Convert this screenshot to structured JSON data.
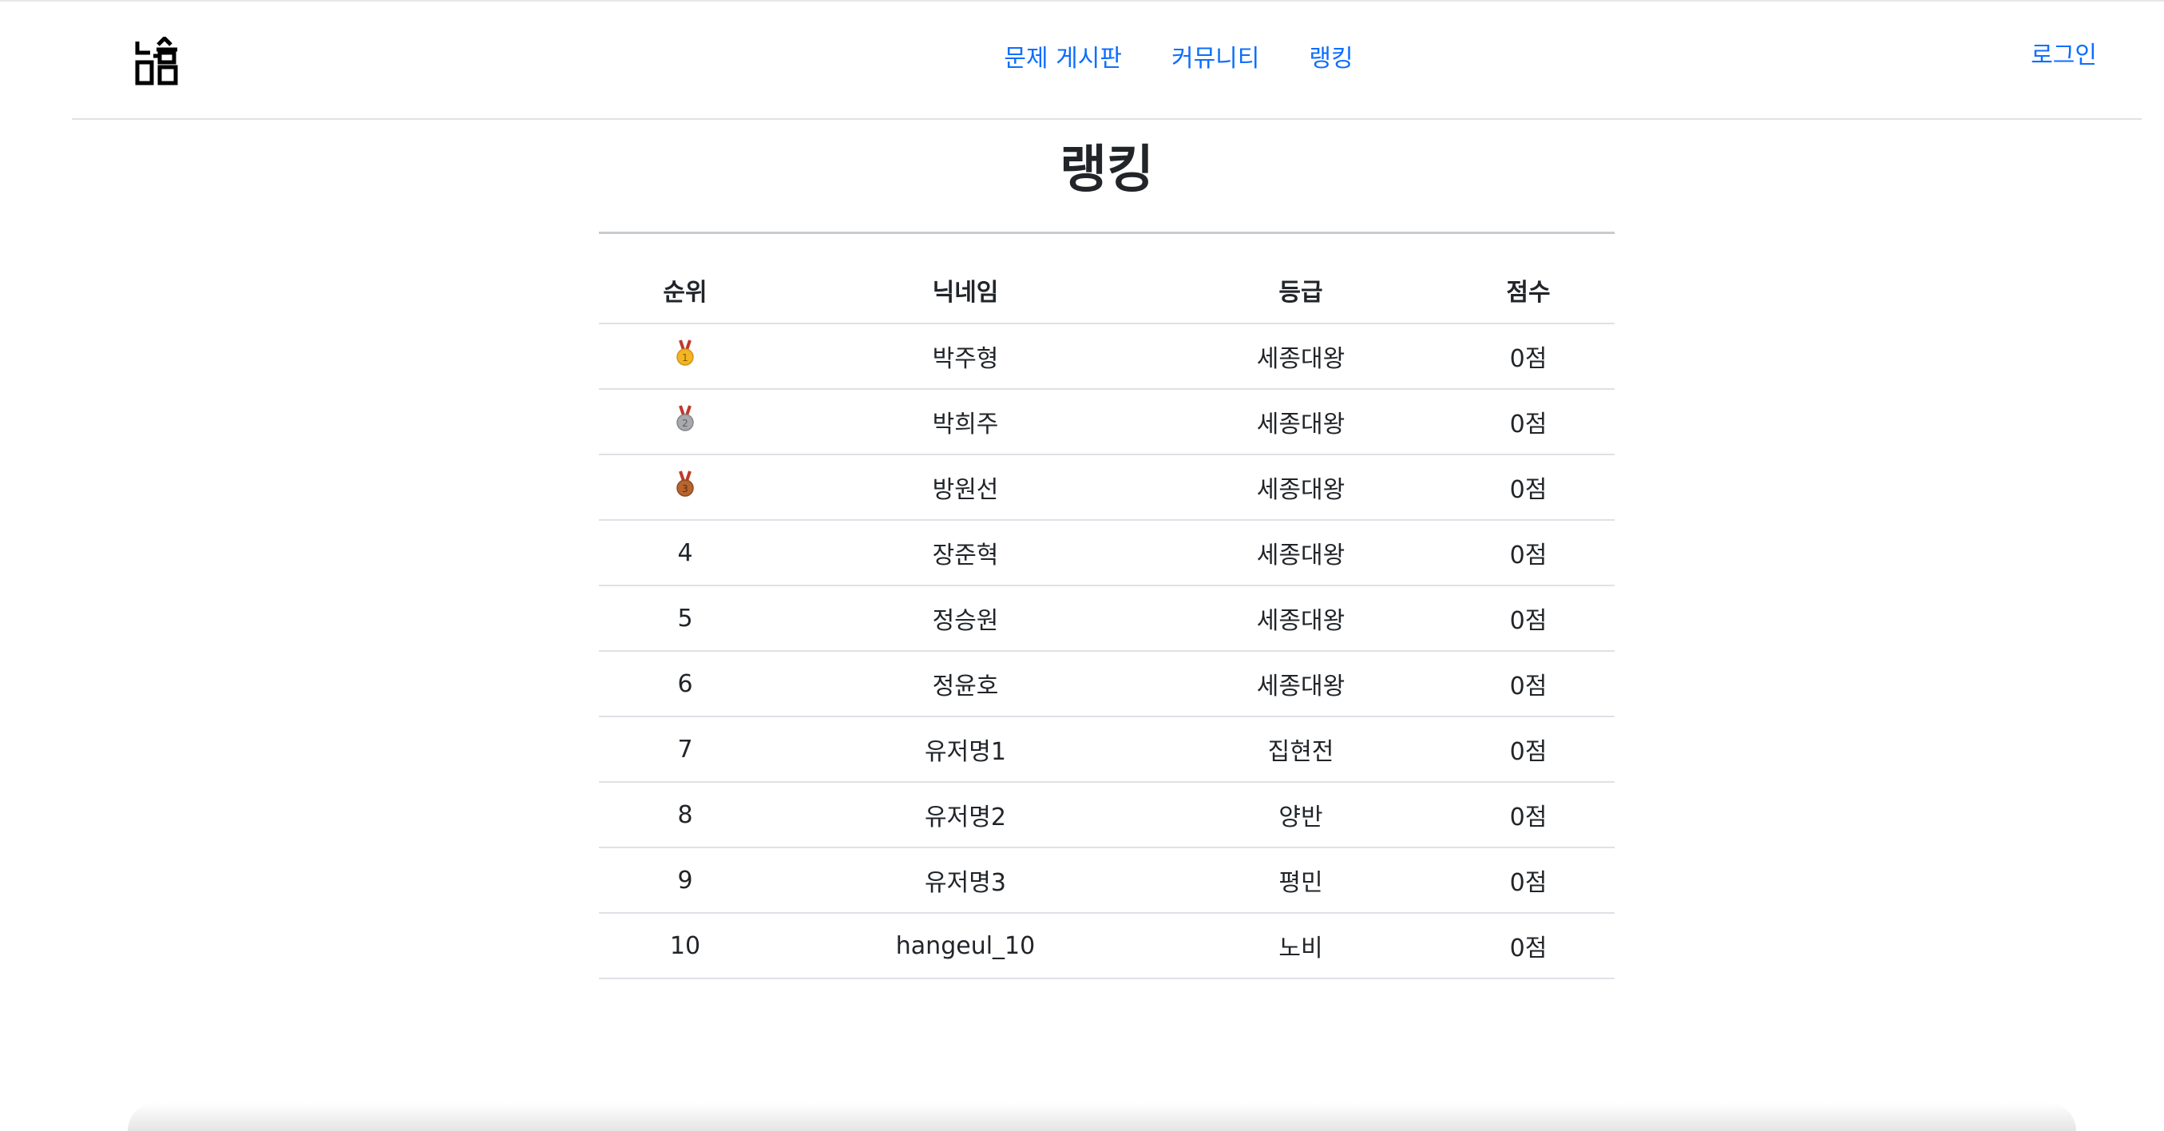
{
  "header": {
    "nav": [
      {
        "label": "문제 게시판"
      },
      {
        "label": "커뮤니티"
      },
      {
        "label": "랭킹"
      }
    ],
    "login_label": "로그인",
    "logo_icon": "hangul-logo-icon"
  },
  "main": {
    "title": "랭킹",
    "table": {
      "headers": {
        "rank": "순위",
        "nickname": "닉네임",
        "grade": "등급",
        "score": "점수"
      },
      "rows": [
        {
          "rank": "1",
          "medal": "gold-medal-icon",
          "nickname": "박주형",
          "grade": "세종대왕",
          "score": "0점"
        },
        {
          "rank": "2",
          "medal": "silver-medal-icon",
          "nickname": "박희주",
          "grade": "세종대왕",
          "score": "0점"
        },
        {
          "rank": "3",
          "medal": "bronze-medal-icon",
          "nickname": "방원선",
          "grade": "세종대왕",
          "score": "0점"
        },
        {
          "rank": "4",
          "nickname": "장준혁",
          "grade": "세종대왕",
          "score": "0점"
        },
        {
          "rank": "5",
          "nickname": "정승원",
          "grade": "세종대왕",
          "score": "0점"
        },
        {
          "rank": "6",
          "nickname": "정윤호",
          "grade": "세종대왕",
          "score": "0점"
        },
        {
          "rank": "7",
          "nickname": "유저명1",
          "grade": "집현전",
          "score": "0점"
        },
        {
          "rank": "8",
          "nickname": "유저명2",
          "grade": "양반",
          "score": "0점"
        },
        {
          "rank": "9",
          "nickname": "유저명3",
          "grade": "평민",
          "score": "0점"
        },
        {
          "rank": "10",
          "nickname": "hangeul_10",
          "grade": "노비",
          "score": "0점"
        }
      ]
    }
  },
  "colors": {
    "link": "#0d6efd",
    "text": "#212529",
    "gold": "#f2b523",
    "silver": "#a8a9ad",
    "bronze": "#b8642d",
    "ribbon": "#c0392b"
  }
}
